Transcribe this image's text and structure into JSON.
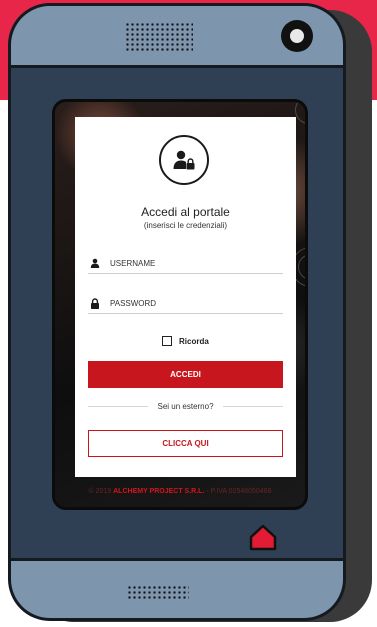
{
  "login_card": {
    "title": "Accedi al portale",
    "subtitle": "(inserisci le credenziali)",
    "username_placeholder": "USERNAME",
    "password_placeholder": "PASSWORD",
    "remember_label": "Ricorda",
    "login_button": "ACCEDI",
    "external_prompt": "Sei un esterno?",
    "external_button": "CLICCA QUI"
  },
  "footer": {
    "year_prefix": "© 2019 ",
    "company": "ALCHEMY PROJECT S.R.L.",
    "vat": " - P.IVA 02546050468"
  },
  "icons": {
    "avatar": "user-lock-icon",
    "username": "user-icon",
    "password": "lock-icon",
    "home": "home-icon"
  },
  "colors": {
    "accent": "#c8161e",
    "brand_band": "#e8264a",
    "phone_body": "#2f4055",
    "phone_bezel": "#7d95ad"
  }
}
